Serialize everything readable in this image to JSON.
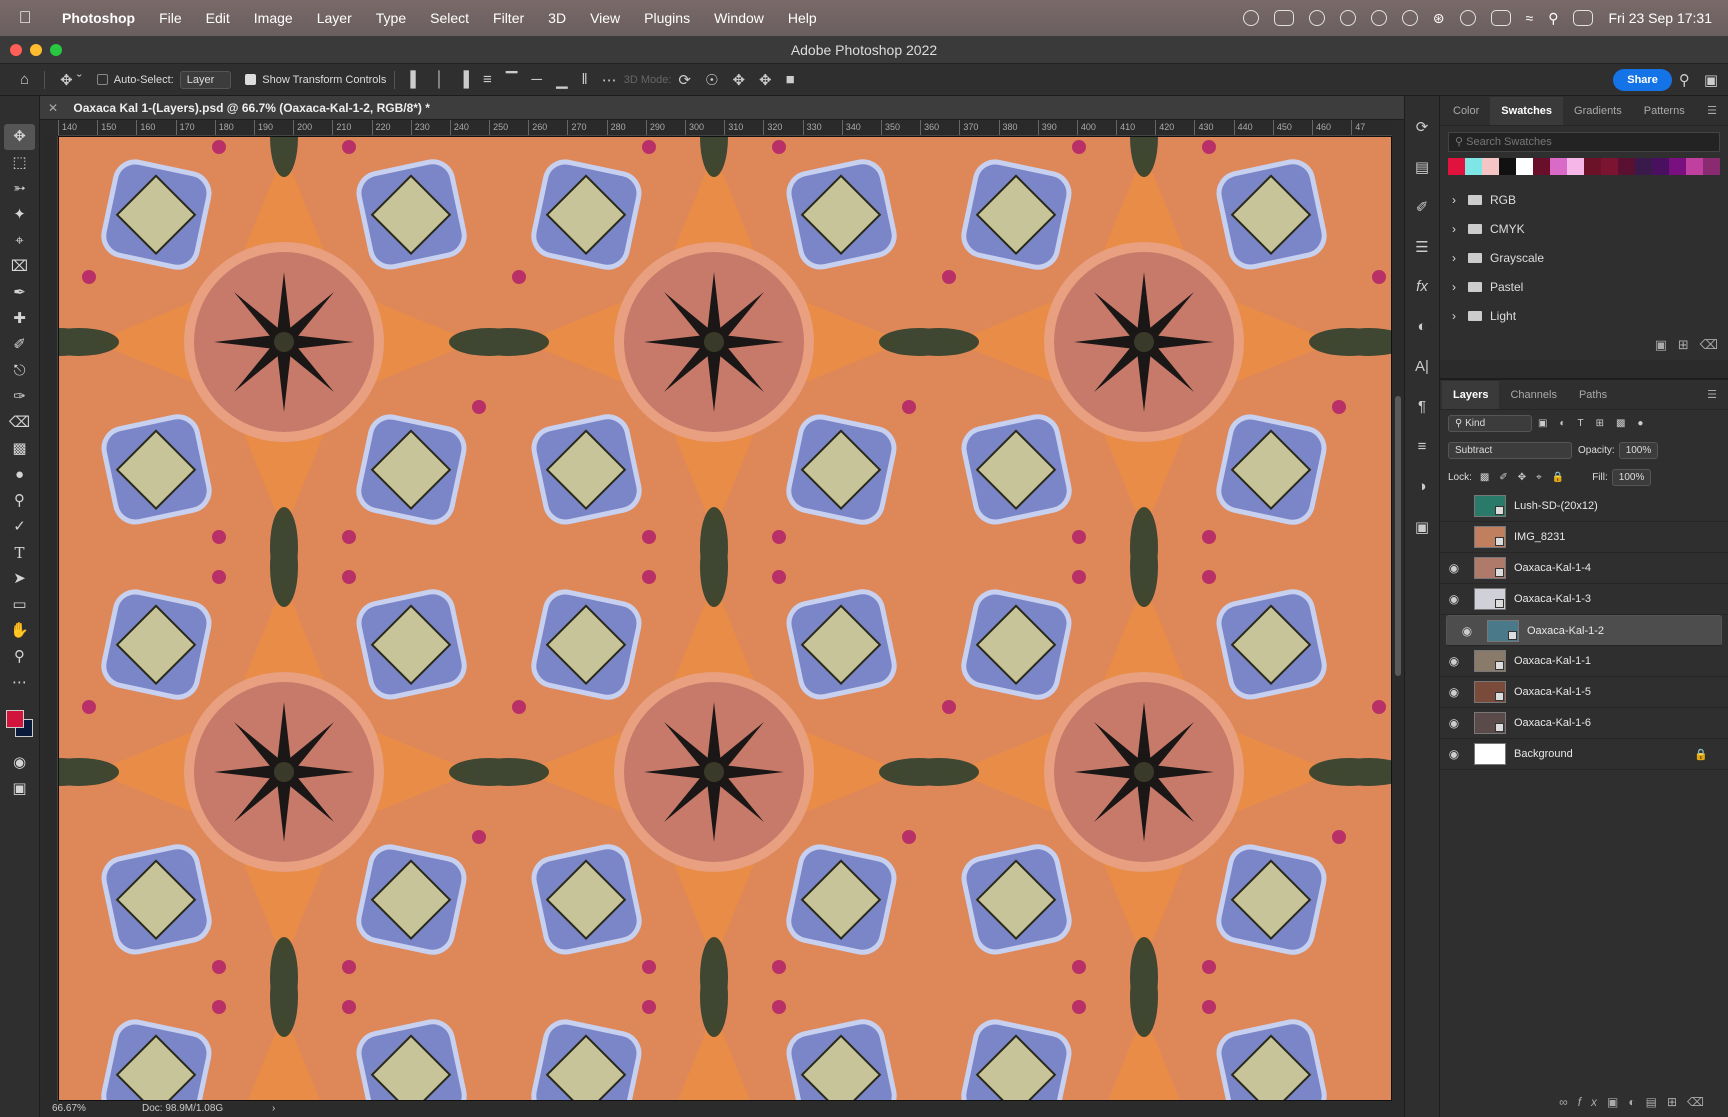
{
  "menubar": {
    "app": "Photoshop",
    "items": [
      "File",
      "Edit",
      "Image",
      "Layer",
      "Type",
      "Select",
      "Filter",
      "3D",
      "View",
      "Plugins",
      "Window",
      "Help"
    ],
    "datetime": "Fri 23 Sep  17:31"
  },
  "window": {
    "title": "Adobe Photoshop 2022"
  },
  "options": {
    "auto_select_label": "Auto-Select:",
    "auto_select_value": "Layer",
    "show_transform_label": "Show Transform Controls",
    "mode_3d_label": "3D Mode:",
    "share_label": "Share"
  },
  "document": {
    "tab_title": "Oaxaca Kal 1-(Layers).psd @ 66.7% (Oaxaca-Kal-1-2, RGB/8*) *"
  },
  "ruler": {
    "h_ticks": [
      "140",
      "150",
      "160",
      "170",
      "180",
      "190",
      "200",
      "210",
      "220",
      "230",
      "240",
      "250",
      "260",
      "270",
      "280",
      "290",
      "300",
      "310",
      "320",
      "330",
      "340",
      "350",
      "360",
      "370",
      "380",
      "390",
      "400",
      "410",
      "420",
      "430",
      "440",
      "450",
      "460",
      "47"
    ]
  },
  "status": {
    "zoom": "66.67%",
    "doc": "Doc: 98.9M/1.08G"
  },
  "swatches_panel": {
    "tabs": [
      "Color",
      "Swatches",
      "Gradients",
      "Patterns"
    ],
    "active_tab": "Swatches",
    "search_placeholder": "Search Swatches",
    "recent_colors": [
      "#e0123e",
      "#7fe6e6",
      "#f5c4c4",
      "#111111",
      "#ffffff",
      "#6a0f2a",
      "#d96ac8",
      "#f7b6e8",
      "#6b1228",
      "#7a1430",
      "#5a1030",
      "#3a1a4a",
      "#4a1060",
      "#7a1080",
      "#c040a0",
      "#8a2a70"
    ],
    "folders": [
      "RGB",
      "CMYK",
      "Grayscale",
      "Pastel",
      "Light"
    ]
  },
  "layers_panel": {
    "tabs": [
      "Layers",
      "Channels",
      "Paths"
    ],
    "active_tab": "Layers",
    "filter_label": "Kind",
    "blend_mode": "Subtract",
    "opacity_label": "Opacity:",
    "opacity_value": "100%",
    "lock_label": "Lock:",
    "fill_label": "Fill:",
    "fill_value": "100%",
    "layers": [
      {
        "name": "Lush-SD-(20x12)",
        "visible": false,
        "selected": false
      },
      {
        "name": "IMG_8231",
        "visible": false,
        "selected": false
      },
      {
        "name": "Oaxaca-Kal-1-4",
        "visible": true,
        "selected": false
      },
      {
        "name": "Oaxaca-Kal-1-3",
        "visible": true,
        "selected": false
      },
      {
        "name": "Oaxaca-Kal-1-2",
        "visible": true,
        "selected": true
      },
      {
        "name": "Oaxaca-Kal-1-1",
        "visible": true,
        "selected": false
      },
      {
        "name": "Oaxaca-Kal-1-5",
        "visible": true,
        "selected": false
      },
      {
        "name": "Oaxaca-Kal-1-6",
        "visible": true,
        "selected": false
      },
      {
        "name": "Background",
        "visible": true,
        "selected": false,
        "locked": true
      }
    ]
  },
  "colors": {
    "foreground": "#d0143c",
    "background": "#0a1a3a",
    "accent": "#1473e6"
  }
}
